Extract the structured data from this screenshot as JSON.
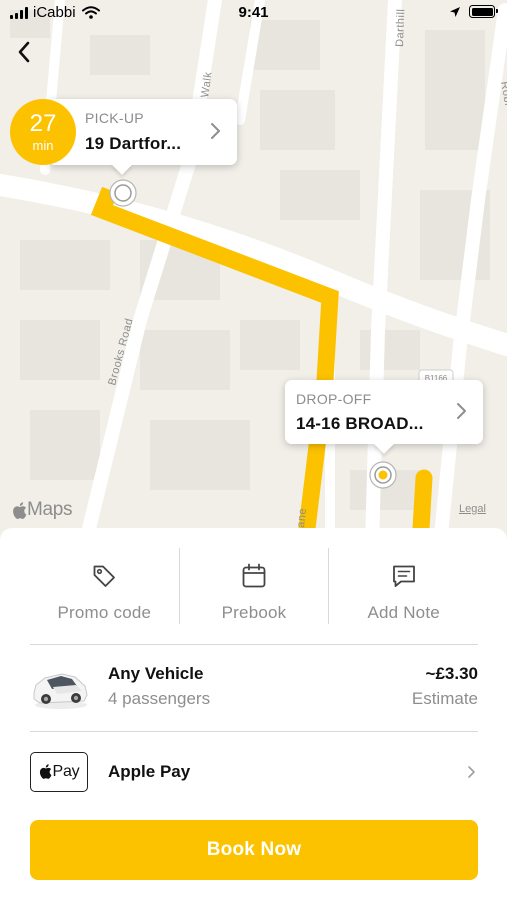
{
  "status_bar": {
    "carrier": "iCabbi",
    "time": "9:41"
  },
  "map": {
    "street_labels": [
      "Walk",
      "Darthill",
      "Brooks Road",
      "Robi",
      "ane",
      "B1166"
    ],
    "attribution": "Maps",
    "legal_label": "Legal",
    "route_color": "#fcc200"
  },
  "pickup": {
    "eta_value": "27",
    "eta_unit": "min",
    "label": "PICK-UP",
    "address": "19 Dartfor..."
  },
  "dropoff": {
    "label": "DROP-OFF",
    "address": "14-16 BROAD..."
  },
  "actions": [
    {
      "label": "Promo code",
      "icon": "tag-icon"
    },
    {
      "label": "Prebook",
      "icon": "calendar-icon"
    },
    {
      "label": "Add Note",
      "icon": "note-icon"
    }
  ],
  "vehicle": {
    "title": "Any Vehicle",
    "passengers": "4 passengers",
    "price": "~£3.30",
    "price_note": "Estimate"
  },
  "payment": {
    "badge": "Pay",
    "label": "Apple Pay"
  },
  "book_button": {
    "label": "Book Now"
  },
  "colors": {
    "accent": "#fcc200",
    "map_background": "#f2efe9"
  }
}
